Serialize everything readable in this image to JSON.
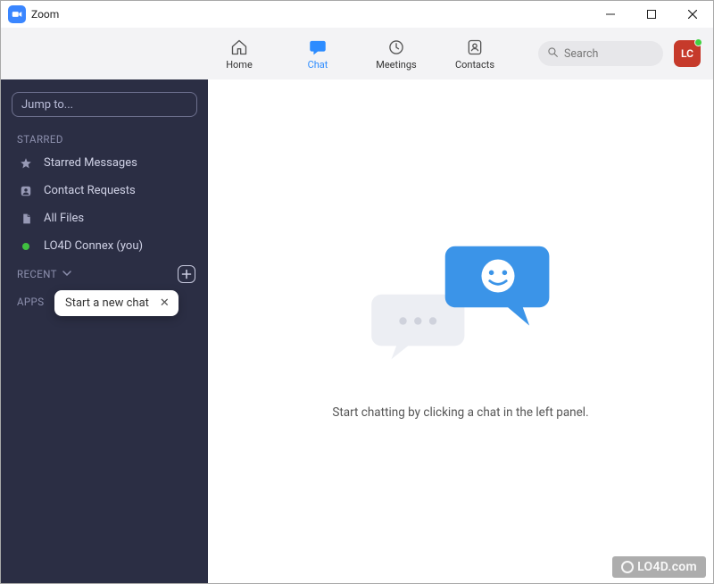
{
  "window": {
    "title": "Zoom"
  },
  "nav": {
    "items": [
      {
        "label": "Home"
      },
      {
        "label": "Chat"
      },
      {
        "label": "Meetings"
      },
      {
        "label": "Contacts"
      }
    ],
    "active_index": 1,
    "search_placeholder": "Search"
  },
  "avatar": {
    "initials": "LC",
    "presence_color": "#41d141",
    "bg": "#c63a2b"
  },
  "sidebar": {
    "jump_placeholder": "Jump to...",
    "sections": {
      "starred_label": "STARRED",
      "recent_label": "RECENT",
      "apps_label": "APPS"
    },
    "starred_items": [
      {
        "icon": "star-icon",
        "label": "Starred Messages"
      },
      {
        "icon": "contact-request-icon",
        "label": "Contact Requests"
      },
      {
        "icon": "file-icon",
        "label": "All Files"
      },
      {
        "icon": "presence-dot",
        "label": "LO4D Connex (you)"
      }
    ],
    "tooltip": {
      "text": "Start a new chat",
      "close": "✕"
    }
  },
  "main": {
    "empty_text": "Start chatting by clicking a chat in the left panel."
  },
  "watermark": "LO4D.com"
}
